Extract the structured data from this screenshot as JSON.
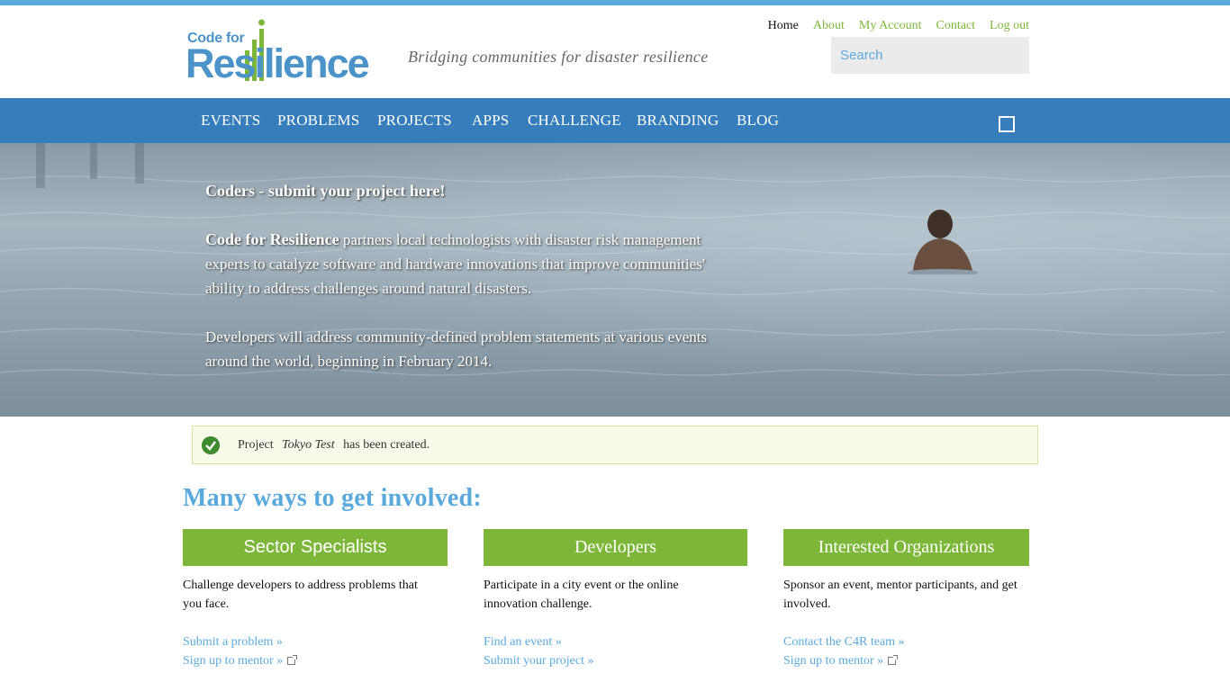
{
  "logo": {
    "small": "Code for",
    "big": "Resilience"
  },
  "tagline": "Bridging communities for disaster resilience",
  "user_menu": [
    {
      "label": "Home"
    },
    {
      "label": "About"
    },
    {
      "label": "My Account"
    },
    {
      "label": "Contact"
    },
    {
      "label": "Log out"
    }
  ],
  "search": {
    "placeholder": "Search",
    "value": ""
  },
  "nav": [
    {
      "label": "EVENTS"
    },
    {
      "label": "PROBLEMS"
    },
    {
      "label": "PROJECTS"
    },
    {
      "label": "APPS"
    },
    {
      "label": "CHALLENGE"
    },
    {
      "label": "BRANDING"
    },
    {
      "label": "BLOG"
    }
  ],
  "hero": {
    "cta": "Coders - submit your project here!",
    "lead_strong": "Code for Resilience",
    "lead_rest": " partners local technologists with disaster risk management experts to catalyze software and hardware innovations that improve communities' ability to address challenges around natural disasters.",
    "para2": "Developers will address community-defined problem statements at various events around the world, beginning in February 2014."
  },
  "notice": {
    "prefix": "Project",
    "project": "Tokyo Test",
    "suffix": "has been created."
  },
  "section_title": "Many ways to get involved:",
  "columns": [
    {
      "title": "Sector Specialists",
      "desc": "Challenge developers to address problems that you face.",
      "links": [
        {
          "label": "Submit a problem »"
        },
        {
          "label": "Sign up to mentor »"
        }
      ]
    },
    {
      "title": "Developers",
      "desc": "Participate in a city event or the online innovation challenge.",
      "links": [
        {
          "label": "Find an event »"
        },
        {
          "label": "Submit your project »"
        }
      ]
    },
    {
      "title": "Interested Organizations",
      "desc": "Sponsor an event, mentor participants, and get involved.",
      "links": [
        {
          "label": "Contact the C4R team »"
        },
        {
          "label": "Sign up to mentor »"
        }
      ]
    }
  ],
  "colors": {
    "accent_blue": "#5aa9dd",
    "nav_blue": "#367dbb",
    "accent_green": "#7db73a"
  }
}
